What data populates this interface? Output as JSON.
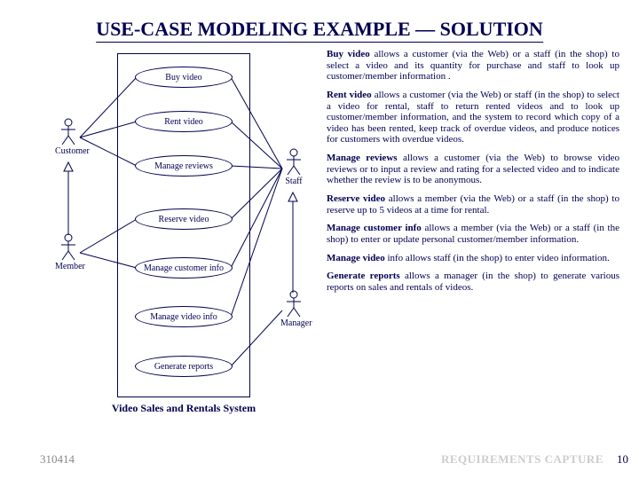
{
  "title": "USE-CASE MODELING EXAMPLE — SOLUTION",
  "diagram": {
    "usecases": {
      "buy": "Buy video",
      "rent": "Rent video",
      "reviews": "Manage reviews",
      "reserve": "Reserve video",
      "custinfo": "Manage customer info",
      "videoinfo": "Manage video info",
      "reports": "Generate reports"
    },
    "actors": {
      "customer": "Customer",
      "member": "Member",
      "staff": "Staff",
      "manager": "Manager"
    },
    "caption": "Video Sales and Rentals System"
  },
  "descriptions": {
    "buy": {
      "head": "Buy video",
      "body": " allows a customer (via the Web) or a staff (in the shop) to select a video and its quantity for purchase and staff to look up customer/member information ."
    },
    "rent": {
      "head": "Rent video",
      "body": " allows a customer (via the Web) or staff (in the shop) to select a video for rental, staff to return rented videos and to look up customer/member information, and the system to record which copy of a video has been rented, keep track of overdue videos, and produce notices for customers with overdue videos."
    },
    "reviews": {
      "head": "Manage reviews",
      "body": " allows a customer (via the Web) to browse video reviews or to input a review and rating for a selected video and to indicate whether the review is to be anonymous."
    },
    "reserve": {
      "head": "Reserve video",
      "body": " allows a member (via the Web) or a staff (in the shop) to reserve up to 5 videos at a time for rental."
    },
    "custinfo": {
      "head": "Manage customer info",
      "body": " allows a member (via the Web) or a staff (in the shop) to enter or update personal customer/member information."
    },
    "videoinfo": {
      "head": "Manage video",
      "body": " info allows staff (in the shop) to enter video information."
    },
    "reports": {
      "head": "Generate reports",
      "body": " allows a manager (in the shop) to generate various reports on sales and rentals of videos."
    }
  },
  "footer": {
    "left": "310414",
    "right": "REQUIREMENTS CAPTURE",
    "page": "10"
  }
}
